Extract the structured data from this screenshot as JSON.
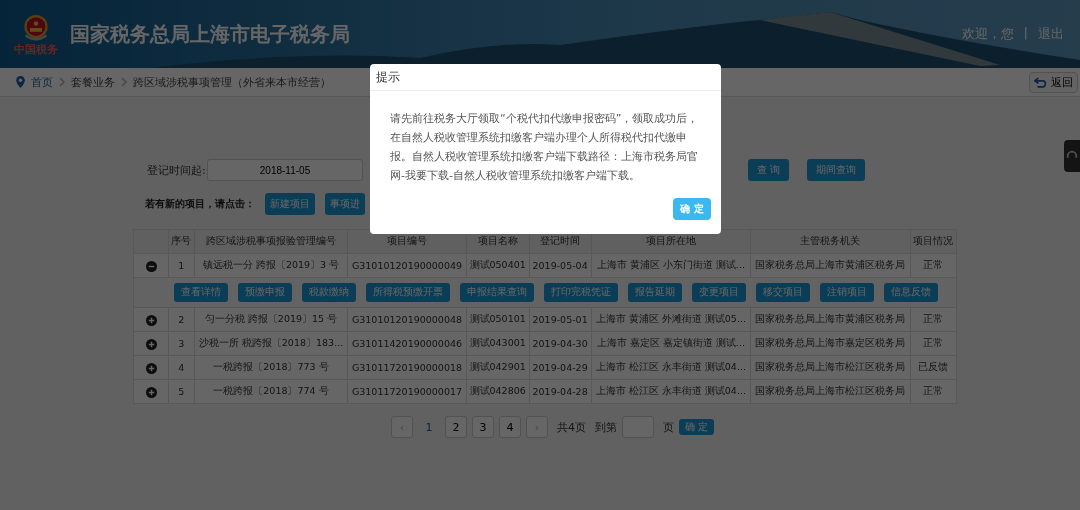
{
  "header": {
    "logo_caption": "中国税务",
    "title": "国家税务总局上海市电子税务局",
    "welcome": "欢迎，您",
    "separator": "|",
    "logout": "退出"
  },
  "breadcrumb": {
    "items": [
      "首页",
      "套餐业务",
      "跨区域涉税事项管理（外省来本市经营）"
    ],
    "back": "返回"
  },
  "filter": {
    "label": "登记时间起:",
    "value": "2018-11-05",
    "buttons": [
      "查 询",
      "期间查询"
    ]
  },
  "new_project": {
    "label": "若有新的项目，请点击：",
    "buttons": [
      "新建项目",
      "事项进"
    ]
  },
  "table": {
    "columns": [
      "",
      "序号",
      "跨区域涉税事项报验管理编号",
      "项目编号",
      "项目名称",
      "登记时间",
      "项目所在地",
      "主管税务机关",
      "项目情况"
    ],
    "rows": [
      {
        "expanded": true,
        "cells": [
          "",
          "1",
          "镇远税一分 跨报〔2019〕3 号",
          "G31010120190000049",
          "测试050401",
          "2019-05-04",
          "上海市 黄浦区 小东门街道 测试...",
          "国家税务总局上海市黄浦区税务局",
          "正常"
        ]
      },
      {
        "expanded": false,
        "cells": [
          "",
          "2",
          "匀一分税 跨报〔2019〕15 号",
          "G31010120190000048",
          "测试050101",
          "2019-05-01",
          "上海市 黄浦区 外滩街道 测试05...",
          "国家税务总局上海市黄浦区税务局",
          "正常"
        ]
      },
      {
        "expanded": false,
        "cells": [
          "",
          "3",
          "沙税一所 税跨报〔2018〕183...",
          "G31011420190000046",
          "测试043001",
          "2019-04-30",
          "上海市 嘉定区 嘉定镇街道 测试...",
          "国家税务总局上海市嘉定区税务局",
          "正常"
        ]
      },
      {
        "expanded": false,
        "cells": [
          "",
          "4",
          "一税跨报〔2018〕773 号",
          "G31011720190000018",
          "测试042901",
          "2019-04-29",
          "上海市 松江区 永丰街道 测试04...",
          "国家税务总局上海市松江区税务局",
          "已反馈"
        ]
      },
      {
        "expanded": false,
        "cells": [
          "",
          "5",
          "一税跨报〔2018〕774 号",
          "G31011720190000017",
          "测试042806",
          "2019-04-28",
          "上海市 松江区 永丰街道 测试04...",
          "国家税务总局上海市松江区税务局",
          "正常"
        ]
      }
    ],
    "actions": [
      "查看详情",
      "预缴申报",
      "税款缴纳",
      "所得税预缴开票",
      "申报结果查询",
      "打印完税凭证",
      "报告延期",
      "变更项目",
      "移交项目",
      "注销项目",
      "信息反馈"
    ]
  },
  "pagination": {
    "prev": "‹",
    "pages": [
      {
        "label": "1",
        "selected": true
      },
      {
        "label": "2",
        "selected": false
      },
      {
        "label": "3",
        "selected": false
      },
      {
        "label": "4",
        "selected": false
      }
    ],
    "next": "›",
    "total": "共4页",
    "goto": "到第",
    "unit": "页",
    "confirm": "确 定"
  },
  "dialog": {
    "title": "提示",
    "message": "请先前往税务大厅领取“个税代扣代缴申报密码”，领取成功后，在自然人税收管理系统扣缴客户端办理个人所得税代扣代缴申报。自然人税收管理系统扣缴客户端下载路径：上海市税务局官网-我要下载-自然人税收管理系统扣缴客户端下载。",
    "ok": "确 定"
  }
}
